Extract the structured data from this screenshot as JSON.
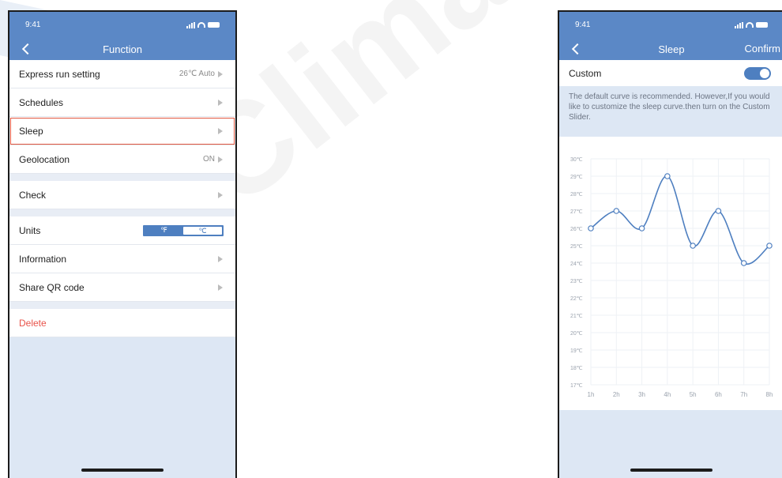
{
  "status_bar": {
    "time": "9:41"
  },
  "function_screen": {
    "title": "Function",
    "rows": [
      {
        "label": "Express run setting",
        "value": "26℃ Auto"
      },
      {
        "label": "Schedules"
      },
      {
        "label": "Sleep"
      },
      {
        "label": "Geolocation",
        "value": "ON"
      },
      {
        "label": "Check"
      },
      {
        "label": "Units",
        "unit_options": [
          "℉",
          "℃"
        ],
        "selected_unit": "℃"
      },
      {
        "label": "Information"
      },
      {
        "label": "Share QR code"
      },
      {
        "label": "Delete"
      }
    ]
  },
  "sleep_screen": {
    "title": "Sleep",
    "confirm": "Confirm",
    "custom_label": "Custom",
    "custom_enabled": true,
    "description": "The default curve is recommended. However,If you would like to customize the sleep curve.then turn on the Custom Slider."
  },
  "chart_data": {
    "type": "line",
    "x": [
      "1h",
      "2h",
      "3h",
      "4h",
      "5h",
      "6h",
      "7h",
      "8h"
    ],
    "series": [
      {
        "values": [
          26,
          27,
          26,
          29,
          25,
          27,
          24,
          25
        ]
      }
    ],
    "y_ticks": [
      "30℃",
      "29℃",
      "28℃",
      "27℃",
      "26℃",
      "25℃",
      "24℃",
      "23℃",
      "22℃",
      "21℃",
      "20℃",
      "19℃",
      "18℃",
      "17℃"
    ],
    "ylim": [
      17,
      30
    ],
    "grid": true
  },
  "colors": {
    "accent": "#5b88c6",
    "highlight": "#e0563f",
    "delete": "#e8534a",
    "curve": "#4e7fc0"
  }
}
